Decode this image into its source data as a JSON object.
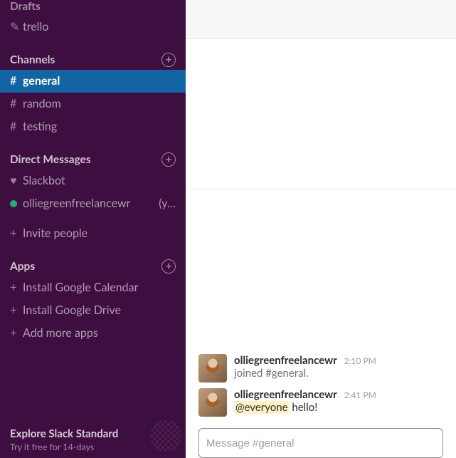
{
  "sidebar": {
    "drafts_label": "Drafts",
    "drafts_items": [
      {
        "icon": "pencil",
        "label": "trello"
      }
    ],
    "channels_label": "Channels",
    "channels": [
      {
        "prefix": "#",
        "label": "general",
        "active": true
      },
      {
        "prefix": "#",
        "label": "random",
        "active": false
      },
      {
        "prefix": "#",
        "label": "testing",
        "active": false
      }
    ],
    "dms_label": "Direct Messages",
    "dms": [
      {
        "kind": "heart",
        "label": "Slackbot",
        "suffix": ""
      },
      {
        "kind": "dot",
        "label": "olliegreenfreelancewr",
        "suffix": "(y…"
      }
    ],
    "invite_label": "Invite people",
    "apps_label": "Apps",
    "apps": [
      {
        "label": "Install Google Calendar"
      },
      {
        "label": "Install Google Drive"
      },
      {
        "label": "Add more apps"
      }
    ],
    "explore_title": "Explore Slack Standard",
    "explore_sub": "Try it free for 14-days"
  },
  "messages": [
    {
      "name": "olliegreenfreelancewr",
      "time": "2:10 PM",
      "system_text": "joined #general."
    },
    {
      "name": "olliegreenfreelancewr",
      "time": "2:41 PM",
      "mention": "@everyone",
      "text_after": " hello!"
    }
  ],
  "composer": {
    "placeholder": "Message #general"
  }
}
